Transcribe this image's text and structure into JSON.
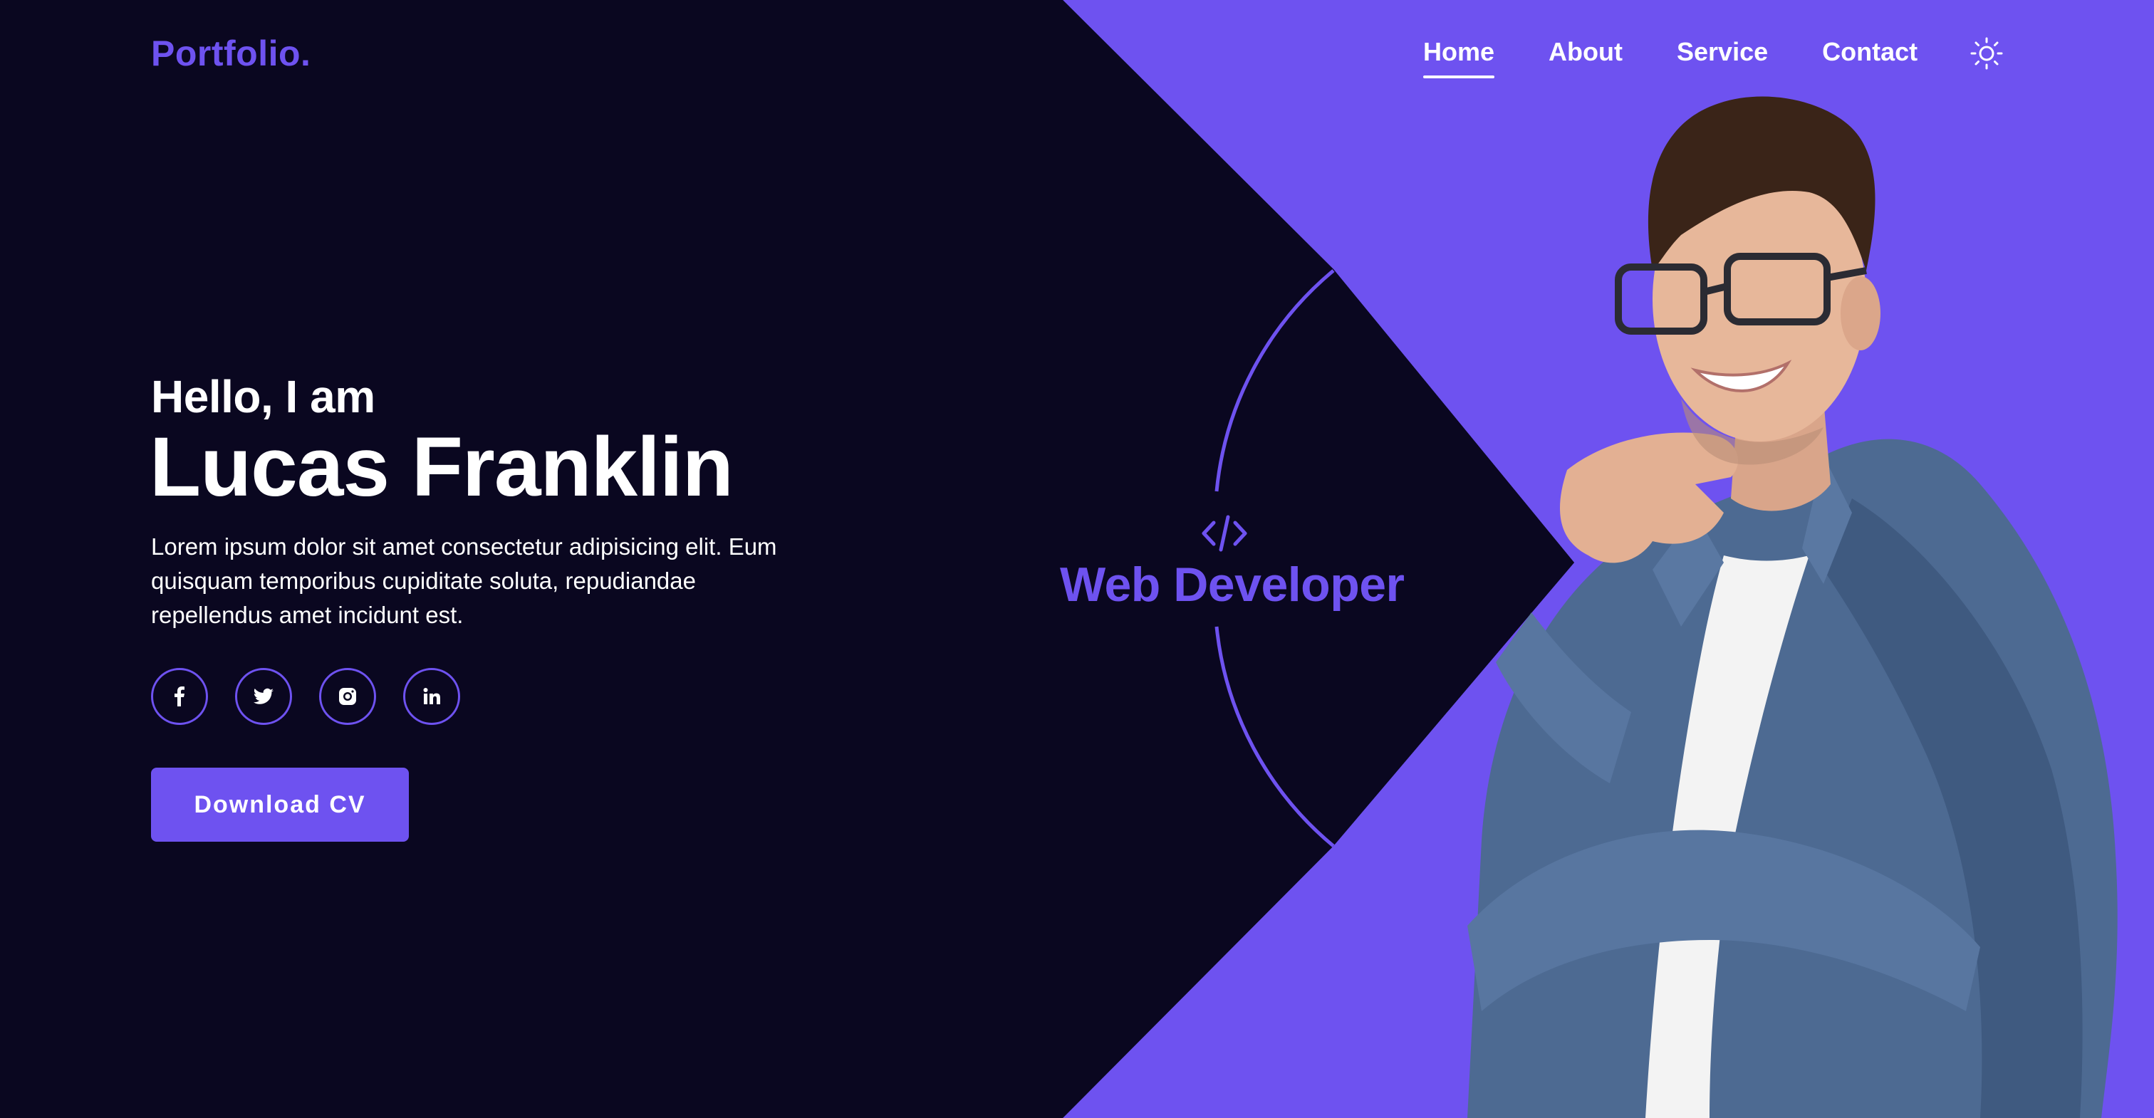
{
  "colors": {
    "accent": "#6e52f0",
    "background": "#0a0720",
    "text": "#ffffff",
    "shirt": "#4d6a92",
    "skin": "#e7b79a",
    "hair": "#3a2418"
  },
  "header": {
    "logo": "Portfolio.",
    "nav": [
      {
        "label": "Home",
        "active": true
      },
      {
        "label": "About",
        "active": false
      },
      {
        "label": "Service",
        "active": false
      },
      {
        "label": "Contact",
        "active": false
      }
    ],
    "theme_toggle_icon": "sun-icon"
  },
  "hero": {
    "greeting": "Hello, I am",
    "name": "Lucas Franklin",
    "description": "Lorem ipsum dolor sit amet consectetur adipisicing elit. Eum quisquam temporibus cupiditate soluta, repudiandae repellendus amet incidunt est.",
    "socials": [
      {
        "icon": "facebook-icon"
      },
      {
        "icon": "twitter-icon"
      },
      {
        "icon": "instagram-icon"
      },
      {
        "icon": "linkedin-icon"
      }
    ],
    "cta_label": "Download CV",
    "role_icon": "code-icon",
    "role": "Web Developer"
  }
}
